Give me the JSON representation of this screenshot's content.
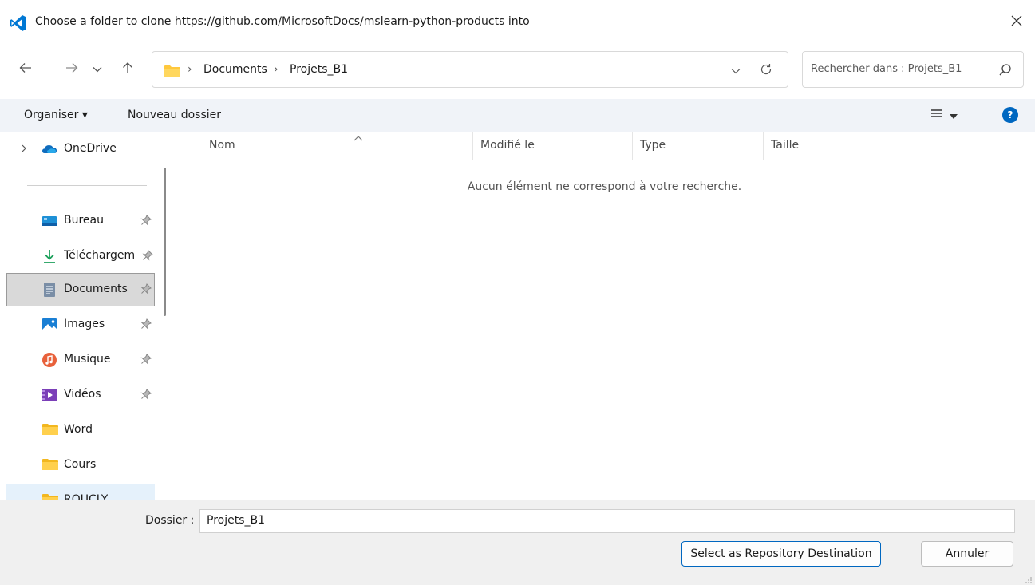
{
  "title_bar": {
    "title": "Choose a folder to clone https://github.com/MicrosoftDocs/mslearn-python-products into",
    "app_icon": "vscode-icon",
    "close_icon": "close-icon"
  },
  "navigation": {
    "back_icon": "arrow-left-icon",
    "forward_icon": "arrow-right-icon",
    "recent_icon": "chevron-down-icon",
    "up_icon": "arrow-up-icon"
  },
  "address_bar": {
    "breadcrumbs": [
      "Documents",
      "Projets_B1"
    ],
    "separator": "›"
  },
  "search": {
    "placeholder": "Rechercher dans : Projets_B1"
  },
  "command_bar": {
    "organize_label": "Organiser ▾",
    "new_folder_label": "Nouveau dossier"
  },
  "sidebar": {
    "onedrive": "OneDrive",
    "items": [
      {
        "label": "Bureau",
        "icon": "desktop-icon"
      },
      {
        "label": "Téléchargem",
        "icon": "download-icon"
      },
      {
        "label": "Documents",
        "icon": "document-icon"
      },
      {
        "label": "Images",
        "icon": "image-icon"
      },
      {
        "label": "Musique",
        "icon": "music-icon"
      },
      {
        "label": "Vidéos",
        "icon": "video-icon"
      },
      {
        "label": "Word",
        "icon": "folder-icon"
      },
      {
        "label": "Cours",
        "icon": "folder-icon"
      },
      {
        "label": "ROUCLY",
        "icon": "folder-icon"
      }
    ]
  },
  "file_list": {
    "columns": [
      "Nom",
      "Modifié le",
      "Type",
      "Taille"
    ],
    "empty_message": "Aucun élément ne correspond à votre recherche."
  },
  "footer": {
    "folder_label": "Dossier :",
    "folder_value": "Projets_B1",
    "select_button": "Select as Repository Destination",
    "cancel_button": "Annuler"
  },
  "colors": {
    "accent": "#0067c0",
    "vscode_blue": "#0078d4",
    "folder_yellow": "#ffc83d",
    "command_bar_bg": "#f0f3f8",
    "footer_bg": "#f0f0f0"
  }
}
